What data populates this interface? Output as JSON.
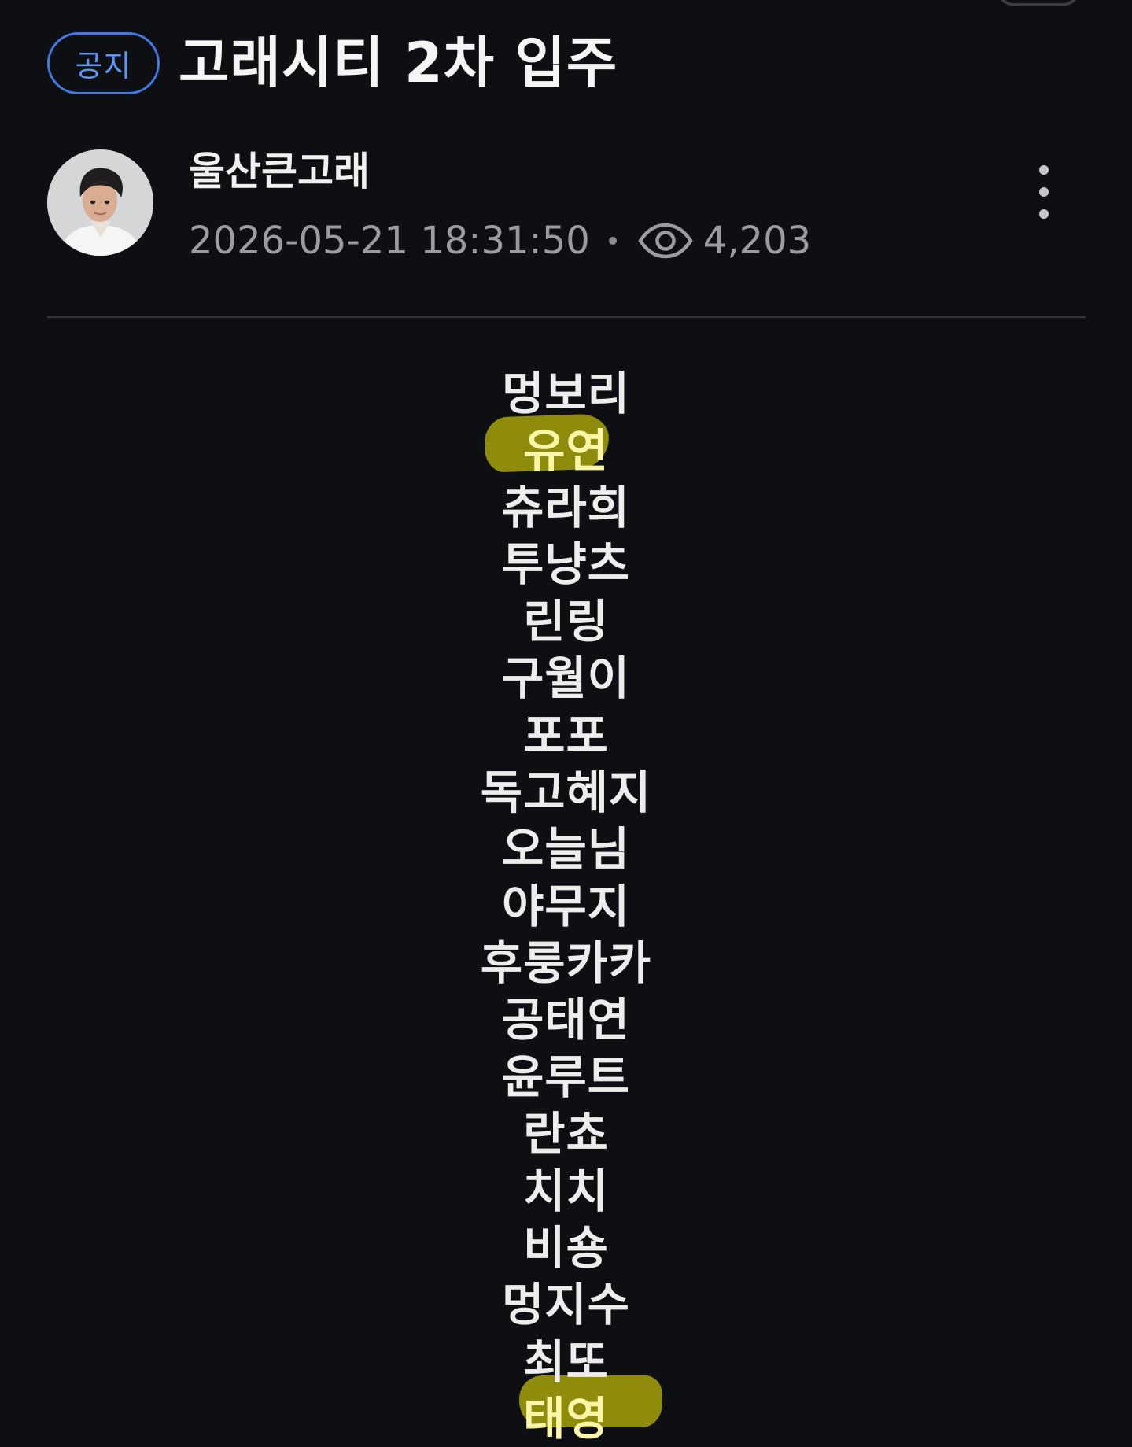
{
  "post": {
    "badge": "공지",
    "title": "고래시티 2차 입주",
    "author": "울산큰고래",
    "datetime": "2026-05-21 18:31:50",
    "views": "4,203"
  },
  "names": [
    "멍보리",
    "유연",
    "츄라희",
    "투냥츠",
    "린링",
    "구월이",
    "포포",
    "독고혜지",
    "오늘님",
    "야무지",
    "후룽카카",
    "공태연",
    "윤루트",
    "란쵸",
    "치치",
    "비숑",
    "멍지수",
    "최또",
    "태영"
  ],
  "highlighted_names": [
    "유연",
    "태영"
  ],
  "colors": {
    "background": "#0d0f12",
    "badge_blue": "#3f7be6",
    "highlight_yellow": "#8e8c0a",
    "meta_gray": "#9a9ca0"
  },
  "icons": {
    "views": "eye-icon",
    "menu": "more-vertical-icon"
  }
}
